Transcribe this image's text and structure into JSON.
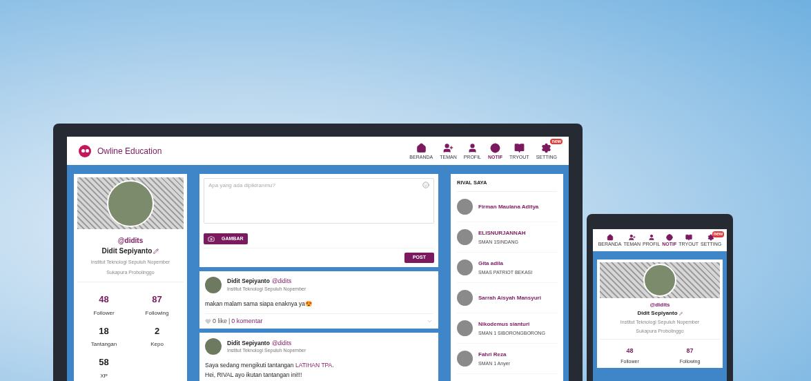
{
  "laptop": {
    "brand": "Owline Education",
    "nav": [
      {
        "label": "BERANDA",
        "selected": false
      },
      {
        "label": "TEMAN",
        "selected": false
      },
      {
        "label": "PROFIL",
        "selected": false
      },
      {
        "label": "NOTIF",
        "selected": true
      },
      {
        "label": "TRYOUT",
        "selected": false
      },
      {
        "label": "SETTING",
        "selected": false,
        "badge": "new"
      }
    ],
    "profile": {
      "handle": "@didits",
      "name": "Didit Sepiyanto",
      "institution": "Institut Teknologi Sepuluh Nopember",
      "city": "Sukapura Probolinggo",
      "stats": [
        {
          "value": "48",
          "label": "Follower",
          "highlighted": true
        },
        {
          "value": "87",
          "label": "Following",
          "highlighted": true
        },
        {
          "value": "18",
          "label": "Tantangan",
          "highlighted": false
        },
        {
          "value": "2",
          "label": "Kepo",
          "highlighted": false
        },
        {
          "value": "58",
          "label": "XP",
          "highlighted": false
        }
      ]
    },
    "composer": {
      "placeholder": "Apa yang ada dipikiranmu?",
      "image_button": "GAMBAR",
      "post_button": "POST"
    },
    "posts": [
      {
        "author": "Didit Sepiyanto",
        "handle": "@didits",
        "institution": "Institut Teknologi Sepuluh Nopember",
        "lines": [
          [
            {
              "text": "makan malam sama siapa enaknya ya😍"
            }
          ]
        ],
        "likes": "0 like",
        "separator": "|",
        "comments": "0 komentar"
      },
      {
        "author": "Didit Sepiyanto",
        "handle": "@didits",
        "institution": "Institut Teknologi Sepuluh Nopember",
        "lines": [
          [
            {
              "text": "Saya sedang mengikuti tantangan "
            },
            {
              "text": "LATIHAN TPA",
              "link": true
            },
            {
              "text": "."
            }
          ],
          [
            {
              "text": "Hei, RIVAL ayo ikutan tantangan ini!!!"
            }
          ]
        ]
      }
    ],
    "rivals": {
      "title": "RIVAL SAYA",
      "items": [
        {
          "name": "Firman Maulana Aditya"
        },
        {
          "name": "ELISNURJANNAH",
          "school": "SMAN 1SINDANG"
        },
        {
          "name": "Gita adila",
          "school": "SMAS PATRIOT BEKASI"
        },
        {
          "name": "Sarrah Aisyah Mansyuri"
        },
        {
          "name": "Nikodemus sianturi",
          "school": "SMAN 1 SIBORONGBORONG"
        },
        {
          "name": "Fahri Reza",
          "school": "SMAN 1 Anyer"
        }
      ]
    }
  },
  "tablet": {
    "nav": [
      {
        "label": "BERANDA",
        "selected": false
      },
      {
        "label": "TEMAN",
        "selected": false
      },
      {
        "label": "PROFIL",
        "selected": false
      },
      {
        "label": "NOTIF",
        "selected": true
      },
      {
        "label": "TRYOUT",
        "selected": false
      },
      {
        "label": "SETTING",
        "selected": false,
        "badge": "new"
      }
    ],
    "profile": {
      "handle": "@didits",
      "name": "Didit Sepiyanto",
      "institution": "Institut Teknologi Sepuluh Nopember",
      "city": "Sukapura Probolinggo",
      "stats": [
        {
          "value": "48",
          "label": "Follower",
          "highlighted": true
        },
        {
          "value": "87",
          "label": "Following",
          "highlighted": true
        }
      ]
    }
  }
}
